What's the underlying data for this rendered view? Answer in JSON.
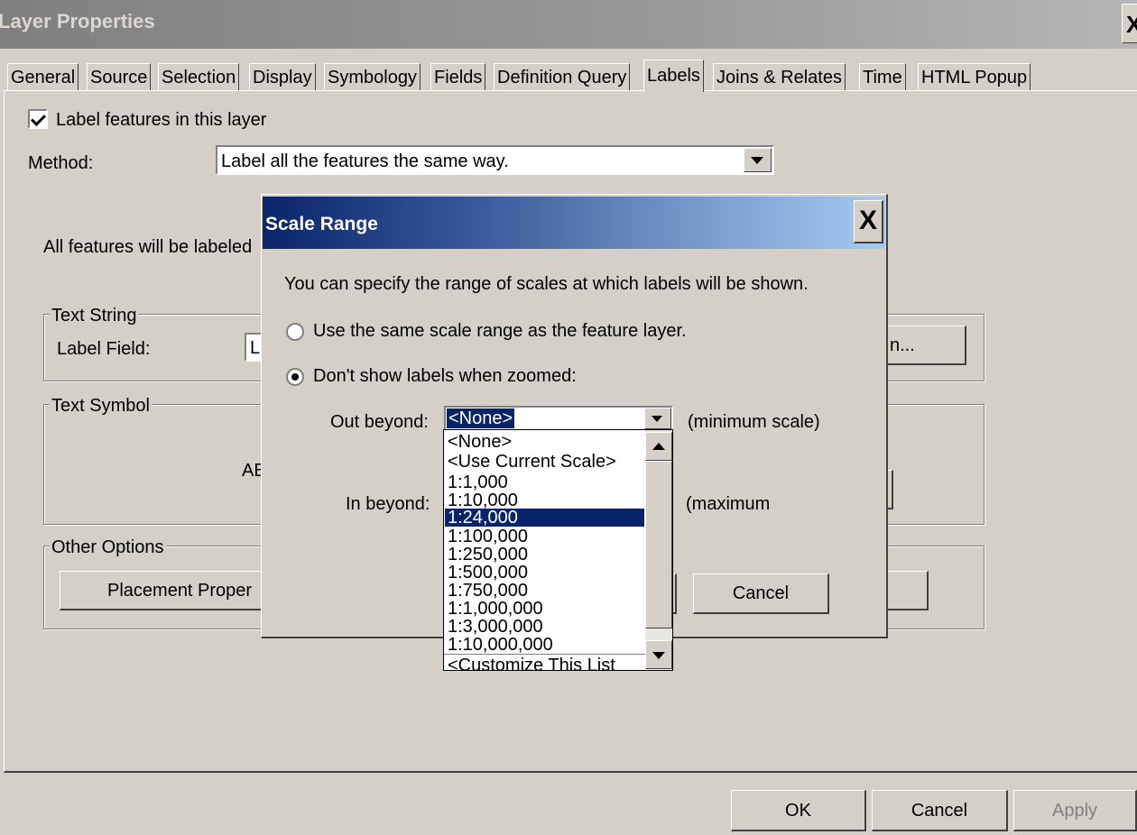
{
  "window": {
    "title": "Layer Properties",
    "close": "X"
  },
  "tabs": [
    "General",
    "Source",
    "Selection",
    "Display",
    "Symbology",
    "Fields",
    "Definition Query",
    "Labels",
    "Joins & Relates",
    "Time",
    "HTML Popup"
  ],
  "active_tab": "Labels",
  "labels_tab": {
    "label_features": "Label features in this layer",
    "method_label": "Method:",
    "method_value": "Label all the features the same way.",
    "all_features_text": "All features will be labeled",
    "text_string_group": "Text String",
    "label_field_label": "Label Field:",
    "label_field_value": "L",
    "expression_button": "n...",
    "text_symbol_group": "Text Symbol",
    "symbol_preview": "AB",
    "other_options_group": "Other Options",
    "placement_button": "Placement Proper"
  },
  "footer": {
    "ok": "OK",
    "cancel": "Cancel",
    "apply": "Apply"
  },
  "dialog": {
    "title": "Scale Range",
    "close": "X",
    "description": "You can specify the range of scales at which labels will be shown.",
    "option_same": "Use the same scale range as the feature layer.",
    "option_custom": "Don't show labels when zoomed:",
    "out_beyond_label": "Out beyond:",
    "out_beyond_value": "<None>",
    "min_scale": "(minimum scale)",
    "in_beyond_label": "In beyond:",
    "max_scale": "(maximum",
    "cancel": "Cancel"
  },
  "dropdown": {
    "items": [
      "<None>",
      "<Use Current Scale>",
      "1:1,000",
      "1:10,000",
      "1:24,000",
      "1:100,000",
      "1:250,000",
      "1:500,000",
      "1:750,000",
      "1:1,000,000",
      "1:3,000,000",
      "1:10,000,000"
    ],
    "selected": "1:24,000",
    "customize": "<Customize This List"
  }
}
